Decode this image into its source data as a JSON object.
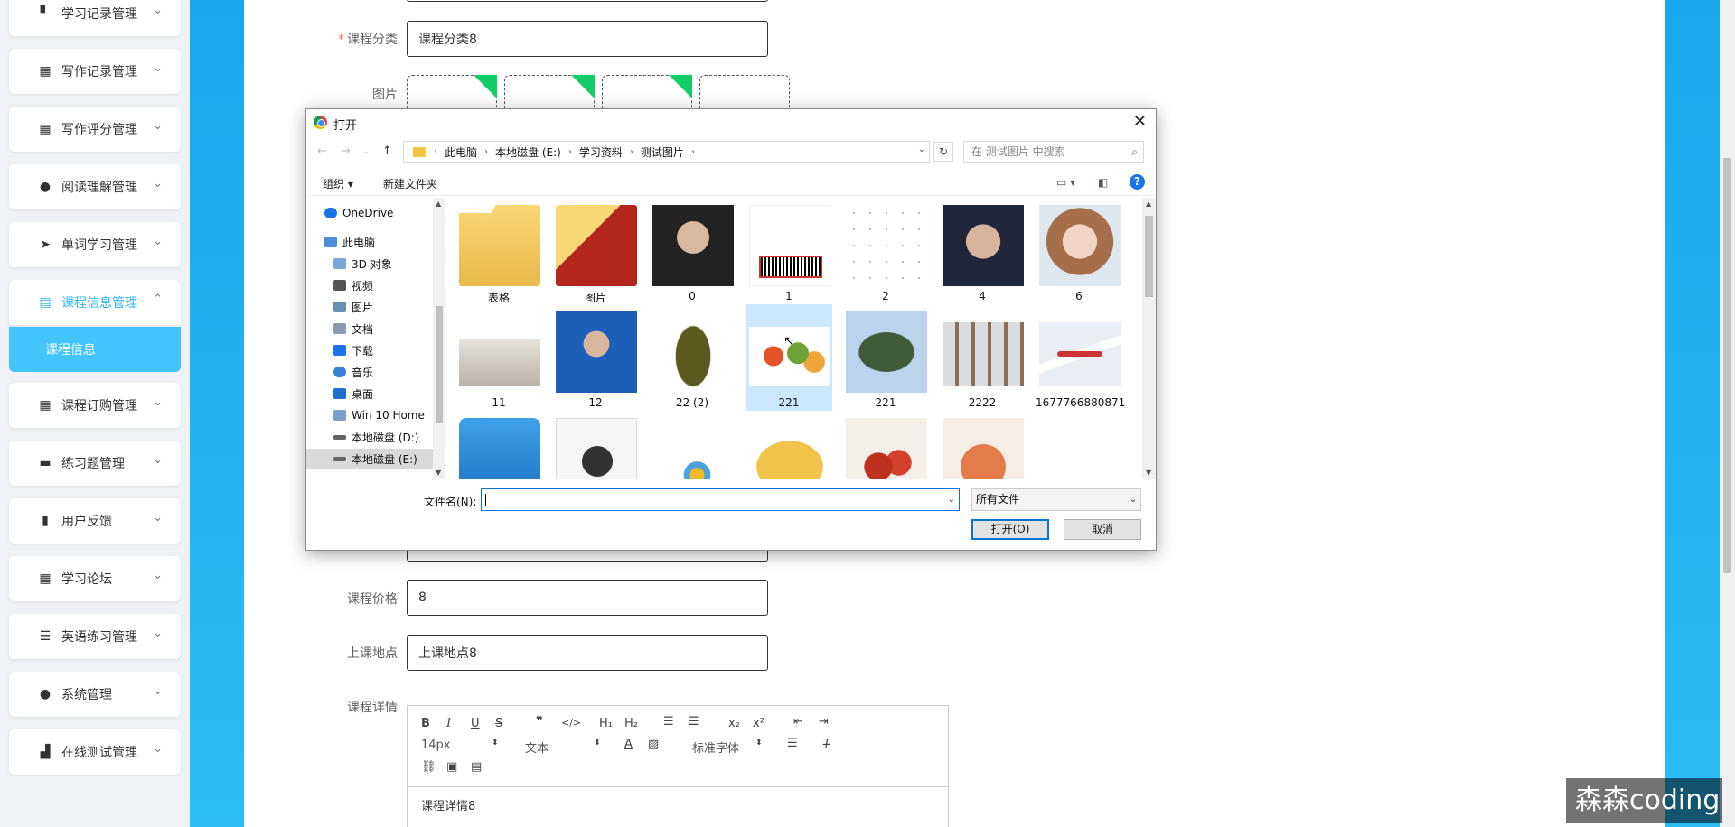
{
  "sidebar": {
    "items": [
      {
        "label": "学习记录管理",
        "icon": "stamp-icon"
      },
      {
        "label": "写作记录管理",
        "icon": "grid-icon"
      },
      {
        "label": "写作评分管理",
        "icon": "grid-icon"
      },
      {
        "label": "阅读理解管理",
        "icon": "user-icon"
      },
      {
        "label": "单词学习管理",
        "icon": "send-icon"
      },
      {
        "label": "课程信息管理",
        "icon": "briefcase-icon"
      },
      {
        "label": "课程订购管理",
        "icon": "grid-icon"
      },
      {
        "label": "练习题管理",
        "icon": "comment-icon"
      },
      {
        "label": "用户反馈",
        "icon": "clipboard-icon"
      },
      {
        "label": "学习论坛",
        "icon": "grid-icon"
      },
      {
        "label": "英语练习管理",
        "icon": "list-icon"
      },
      {
        "label": "系统管理",
        "icon": "user-icon"
      },
      {
        "label": "在线测试管理",
        "icon": "bar-chart-icon"
      }
    ],
    "active_sub": "课程信息"
  },
  "form": {
    "category_label": "课程分类",
    "category_value": "课程分类8",
    "image_label": "图片",
    "price_label": "课程价格",
    "price_value": "8",
    "location_label": "上课地点",
    "location_value": "上课地点8",
    "detail_label": "课程详情",
    "editor": {
      "font_size": "14px",
      "text_type": "文本",
      "font_family": "标准字体",
      "content": "课程详情8"
    }
  },
  "dialog": {
    "title": "打开",
    "breadcrumbs": [
      "此电脑",
      "本地磁盘 (E:)",
      "学习资料",
      "测试图片"
    ],
    "search_placeholder": "在 测试图片 中搜索",
    "organize": "组织 ▾",
    "new_folder": "新建文件夹",
    "nav": [
      {
        "label": "OneDrive",
        "color": "#1a73e8"
      },
      {
        "label": "此电脑",
        "color": "#4a90d9"
      },
      {
        "label": "3D 对象",
        "color": "#7aa7d8"
      },
      {
        "label": "视频",
        "color": "#555555"
      },
      {
        "label": "图片",
        "color": "#6a8fb0"
      },
      {
        "label": "文档",
        "color": "#8a9ab0"
      },
      {
        "label": "下载",
        "color": "#1a73e8"
      },
      {
        "label": "音乐",
        "color": "#3b7ed6"
      },
      {
        "label": "桌面",
        "color": "#1f6fd1"
      },
      {
        "label": "Win 10 Home",
        "color": "#7aa0c8"
      },
      {
        "label": "本地磁盘 (D:)",
        "color": "#666666"
      },
      {
        "label": "本地磁盘 (E:)",
        "color": "#666666"
      }
    ],
    "files": [
      {
        "name": "表格",
        "kind": "folder"
      },
      {
        "name": "图片",
        "kind": "folder-red"
      },
      {
        "name": "0",
        "kind": "portrait"
      },
      {
        "name": "1",
        "kind": "barcode"
      },
      {
        "name": "2",
        "kind": "dots"
      },
      {
        "name": "4",
        "kind": "portrait-man"
      },
      {
        "name": "6",
        "kind": "portrait-woman"
      },
      {
        "name": "11",
        "kind": "certificate"
      },
      {
        "name": "12",
        "kind": "id-photo"
      },
      {
        "name": "22 (2)",
        "kind": "beetle"
      },
      {
        "name": "221",
        "kind": "fruit"
      },
      {
        "name": "221",
        "kind": "beetle-green"
      },
      {
        "name": "2222",
        "kind": "bottles"
      },
      {
        "name": "1677766880871",
        "kind": "plane"
      },
      {
        "name": "",
        "kind": "archive"
      },
      {
        "name": "",
        "kind": "video"
      },
      {
        "name": "",
        "kind": "chart"
      },
      {
        "name": "",
        "kind": "omelette"
      },
      {
        "name": "",
        "kind": "crayfish"
      },
      {
        "name": "",
        "kind": "shrimp"
      }
    ],
    "filename_label": "文件名(N):",
    "filename_value": "",
    "filetype": "所有文件",
    "open_button": "打开(O)",
    "cancel_button": "取消"
  },
  "watermark": "森森coding"
}
